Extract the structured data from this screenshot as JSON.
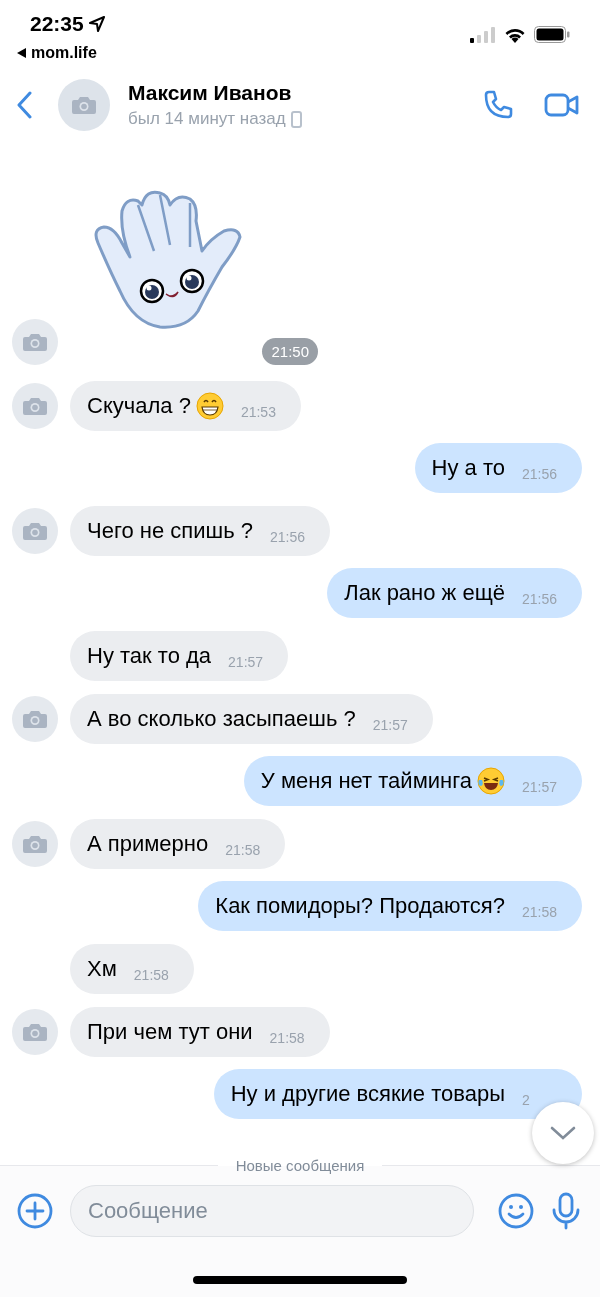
{
  "status_bar": {
    "time": "22:35",
    "back_app": "mom.life"
  },
  "header": {
    "name": "Максим Иванов",
    "last_seen": "был 14 минут назад"
  },
  "messages": [
    {
      "kind": "sticker",
      "incoming": true,
      "avatar": true,
      "time": "21:50"
    },
    {
      "kind": "text",
      "incoming": true,
      "avatar": true,
      "text": "Скучала ?",
      "icon": {
        "kind": "grin"
      },
      "time": "21:53"
    },
    {
      "kind": "text",
      "incoming": false,
      "text": "Ну а то",
      "time": "21:56"
    },
    {
      "kind": "text",
      "incoming": true,
      "avatar": true,
      "text": "Чего не спишь ?",
      "time": "21:56"
    },
    {
      "kind": "text",
      "incoming": false,
      "text": "Лак рано ж ещё",
      "time": "21:56"
    },
    {
      "kind": "text",
      "incoming": true,
      "avatar": false,
      "text": "Ну так то да",
      "time": "21:57"
    },
    {
      "kind": "text",
      "incoming": true,
      "avatar": true,
      "text": "А во сколько засыпаешь ?",
      "time": "21:57"
    },
    {
      "kind": "text",
      "incoming": false,
      "text": "У меня нет тайминга",
      "icon": {
        "kind": "tears"
      },
      "time": "21:57"
    },
    {
      "kind": "text",
      "incoming": true,
      "avatar": true,
      "text": "А примерно",
      "time": "21:58"
    },
    {
      "kind": "text",
      "incoming": false,
      "text": "Как помидоры? Продаются?",
      "time": "21:58"
    },
    {
      "kind": "text",
      "incoming": true,
      "avatar": false,
      "text": "Хм",
      "time": "21:58"
    },
    {
      "kind": "text",
      "incoming": true,
      "avatar": true,
      "text": "При чем тут они",
      "time": "21:58"
    },
    {
      "kind": "text",
      "incoming": false,
      "text": "Ну и другие всякие товары",
      "time": "2"
    }
  ],
  "new_messages_divider": "Новые сообщения",
  "composer": {
    "placeholder": "Сообщение"
  }
}
